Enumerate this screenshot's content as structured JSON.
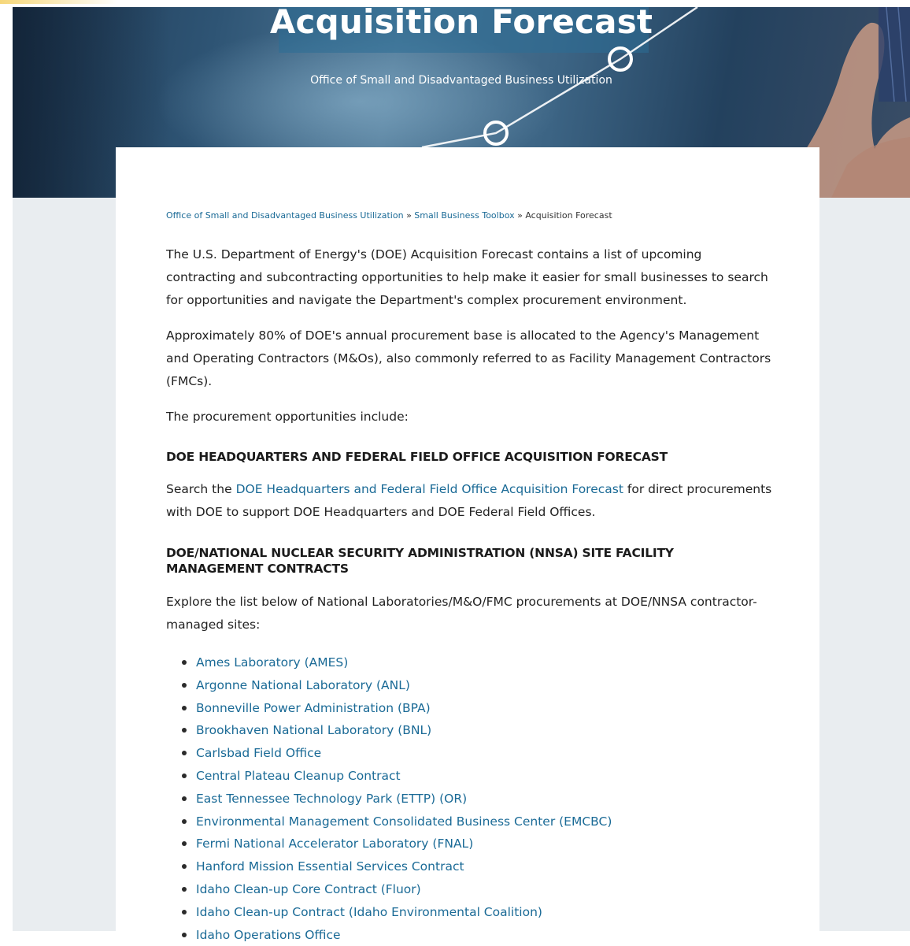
{
  "hero": {
    "title": "Acquisition Forecast",
    "subtitle": "Office of Small and Disadvantaged Business Utilization"
  },
  "breadcrumb": {
    "items": [
      "Office of Small and Disadvantaged Business Utilization",
      "Small Business Toolbox"
    ],
    "separator": "»",
    "current": "Acquisition Forecast"
  },
  "content": {
    "intro_1": "The U.S. Department of Energy's (DOE) Acquisition Forecast contains a list of upcoming contracting and subcontracting opportunities to help make it easier for small businesses to search for opportunities and navigate the Department's complex procurement environment.",
    "intro_2": "Approximately 80% of DOE's annual procurement base is allocated to the Agency's Management and Operating Contractors (M&Os), also commonly referred to as Facility Management Contractors (FMCs).",
    "intro_3": "The procurement opportunities include:",
    "section1_heading": "DOE HEADQUARTERS AND FEDERAL FIELD OFFICE ACQUISITION FORECAST",
    "section1_prefix": "Search the",
    "section1_link": "DOE Headquarters and Federal Field Office Acquisition Forecast",
    "section1_suffix": "for direct procurements with DOE to support DOE Headquarters and DOE Federal Field Offices.",
    "section2_heading": "DOE/NATIONAL NUCLEAR SECURITY ADMINISTRATION (NNSA) SITE FACILITY MANAGEMENT CONTRACTS",
    "section2_text": "Explore the list below of National Laboratories/M&O/FMC procurements at DOE/NNSA contractor-managed sites:"
  },
  "sites": [
    "Ames Laboratory (AMES)",
    "Argonne National Laboratory (ANL)",
    "Bonneville Power Administration (BPA)",
    "Brookhaven National Laboratory (BNL)",
    "Carlsbad Field Office",
    "Central Plateau Cleanup Contract",
    "East Tennessee Technology Park (ETTP) (OR)",
    "Environmental Management Consolidated Business Center (EMCBC)",
    "Fermi National Accelerator Laboratory (FNAL)",
    "Hanford Mission Essential Services Contract",
    "Idaho Clean-up Core Contract (Fluor)",
    "Idaho Clean-up Contract (Idaho Environmental Coalition)",
    "Idaho Operations Office"
  ],
  "colors": {
    "link": "#1a6a96",
    "page_background": "#e9edf0",
    "hero_dark": "#1f3a55"
  }
}
